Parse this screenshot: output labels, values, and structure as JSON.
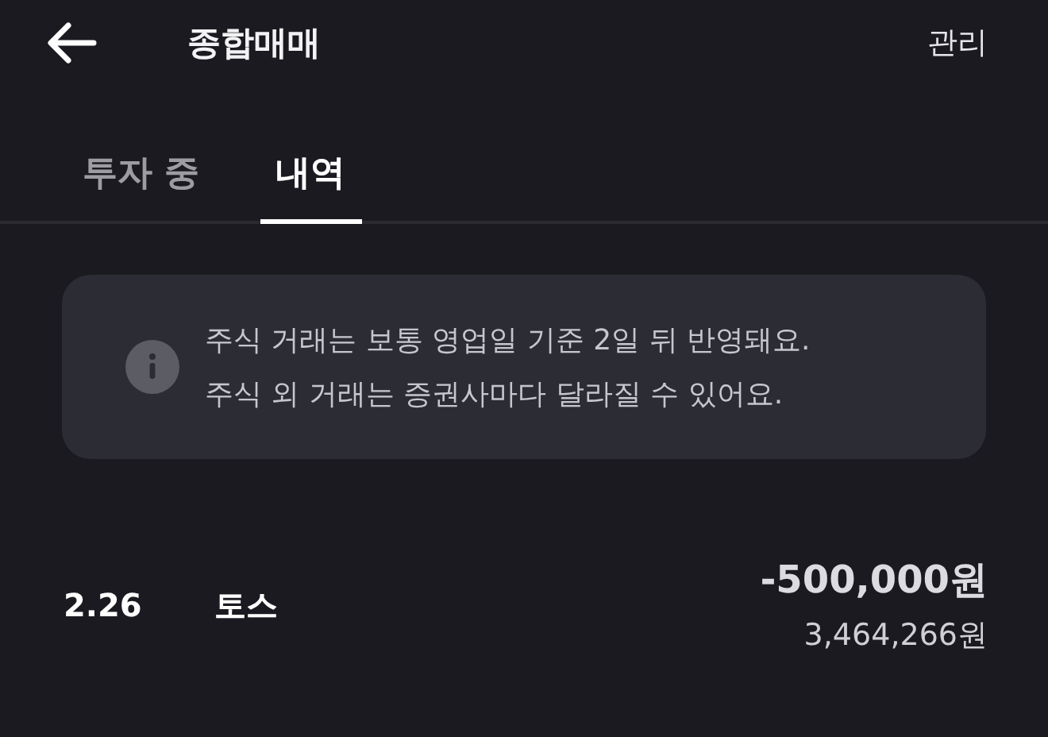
{
  "header": {
    "title": "종합매매",
    "action": "관리"
  },
  "tabs": [
    {
      "label": "투자 중",
      "selected": false
    },
    {
      "label": "내역",
      "selected": true
    }
  ],
  "notice": {
    "lines": [
      "주식 거래는 보통 영업일 기준 2일 뒤 반영돼요.",
      "주식 외 거래는 증권사마다 달라질 수 있어요."
    ]
  },
  "transactions": [
    {
      "date": "2.26",
      "name": "토스",
      "amount": "-500,000원",
      "balance": "3,464,266원"
    }
  ]
}
